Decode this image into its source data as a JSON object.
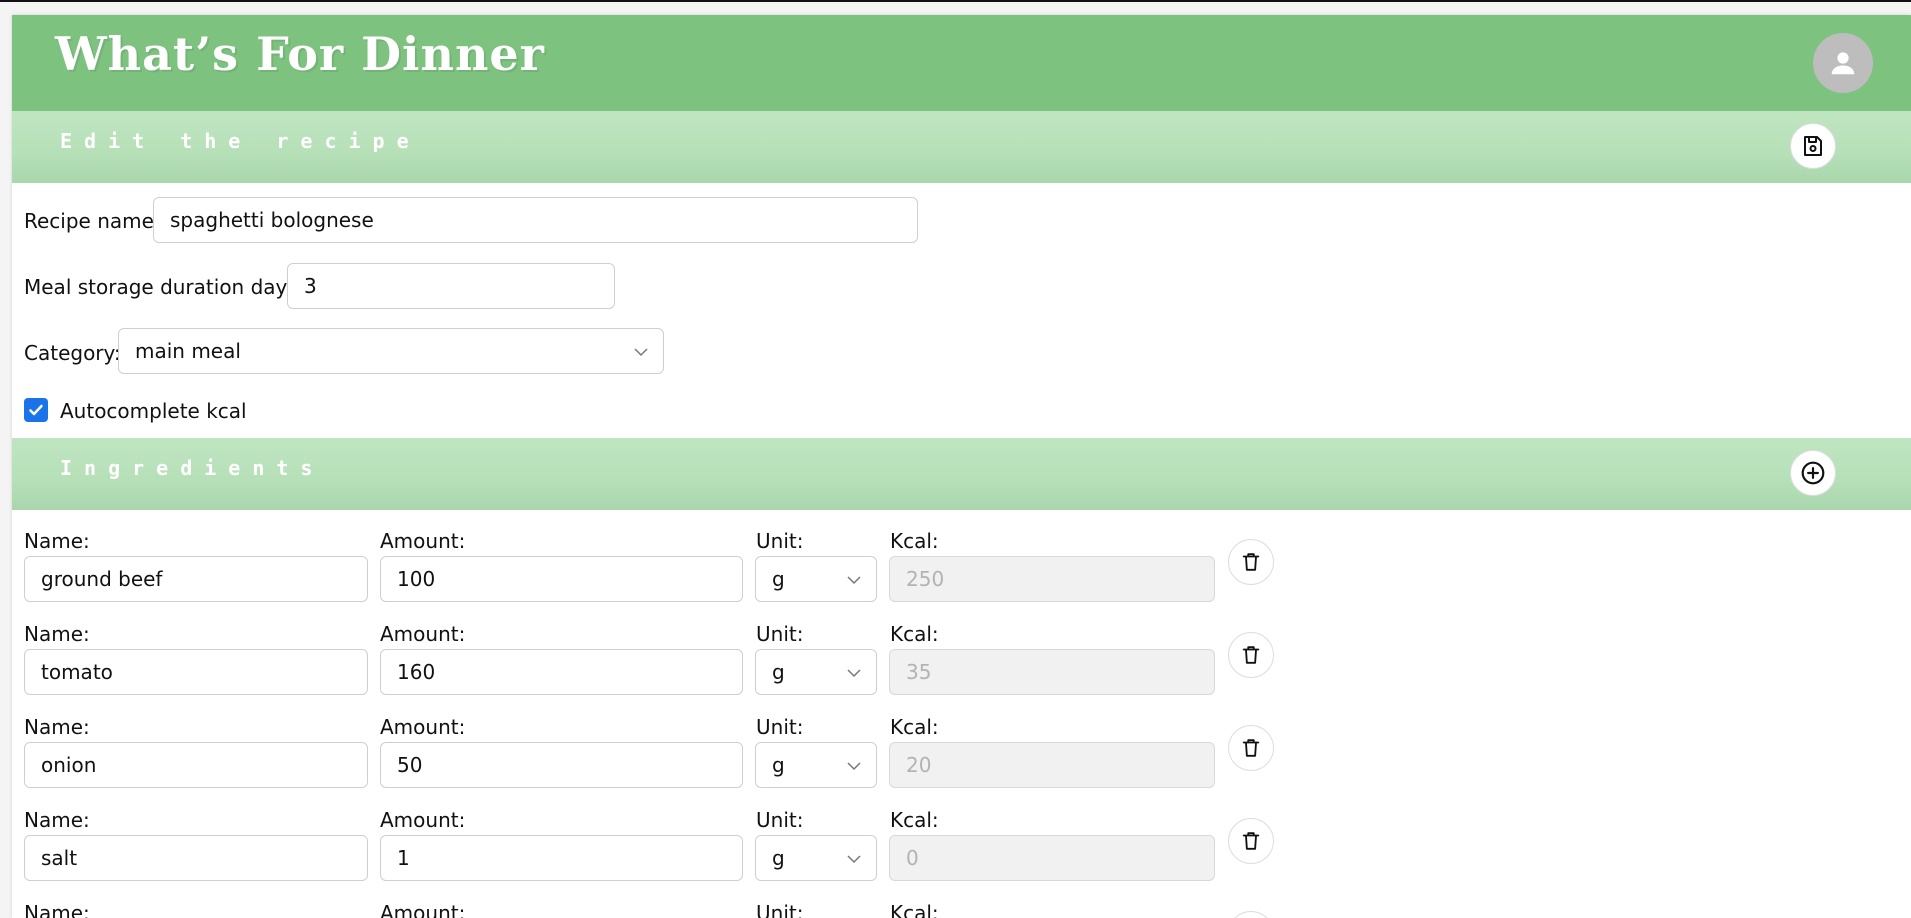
{
  "app": {
    "title": "What’s For Dinner"
  },
  "edit_section": {
    "title": "Edit the recipe"
  },
  "recipe": {
    "name_label": "Recipe name:",
    "name_value": "spaghetti bolognese",
    "storage_label": "Meal storage duration days:",
    "storage_value": "3",
    "category_label": "Category:",
    "category_value": "main meal",
    "autocomplete_label": "Autocomplete kcal",
    "autocomplete_checked": true
  },
  "ingredients_section": {
    "title": "Ingredients"
  },
  "ingredient_labels": {
    "name": "Name:",
    "amount": "Amount:",
    "unit": "Unit:",
    "kcal": "Kcal:"
  },
  "ingredients": [
    {
      "name": "ground beef",
      "amount": "100",
      "unit": "g",
      "kcal": "250"
    },
    {
      "name": "tomato",
      "amount": "160",
      "unit": "g",
      "kcal": "35"
    },
    {
      "name": "onion",
      "amount": "50",
      "unit": "g",
      "kcal": "20"
    },
    {
      "name": "salt",
      "amount": "1",
      "unit": "g",
      "kcal": "0"
    }
  ],
  "colors": {
    "header": "#7dc37f",
    "section_bar": "#b6e0b8",
    "checkbox": "#1a73e8",
    "avatar": "#bdbdbd"
  },
  "icons": {
    "avatar": "person-icon",
    "save": "floppy-disk-icon",
    "add": "plus-circle-icon",
    "delete": "trash-icon",
    "dropdown": "chevron-down-icon",
    "check": "check-icon"
  }
}
